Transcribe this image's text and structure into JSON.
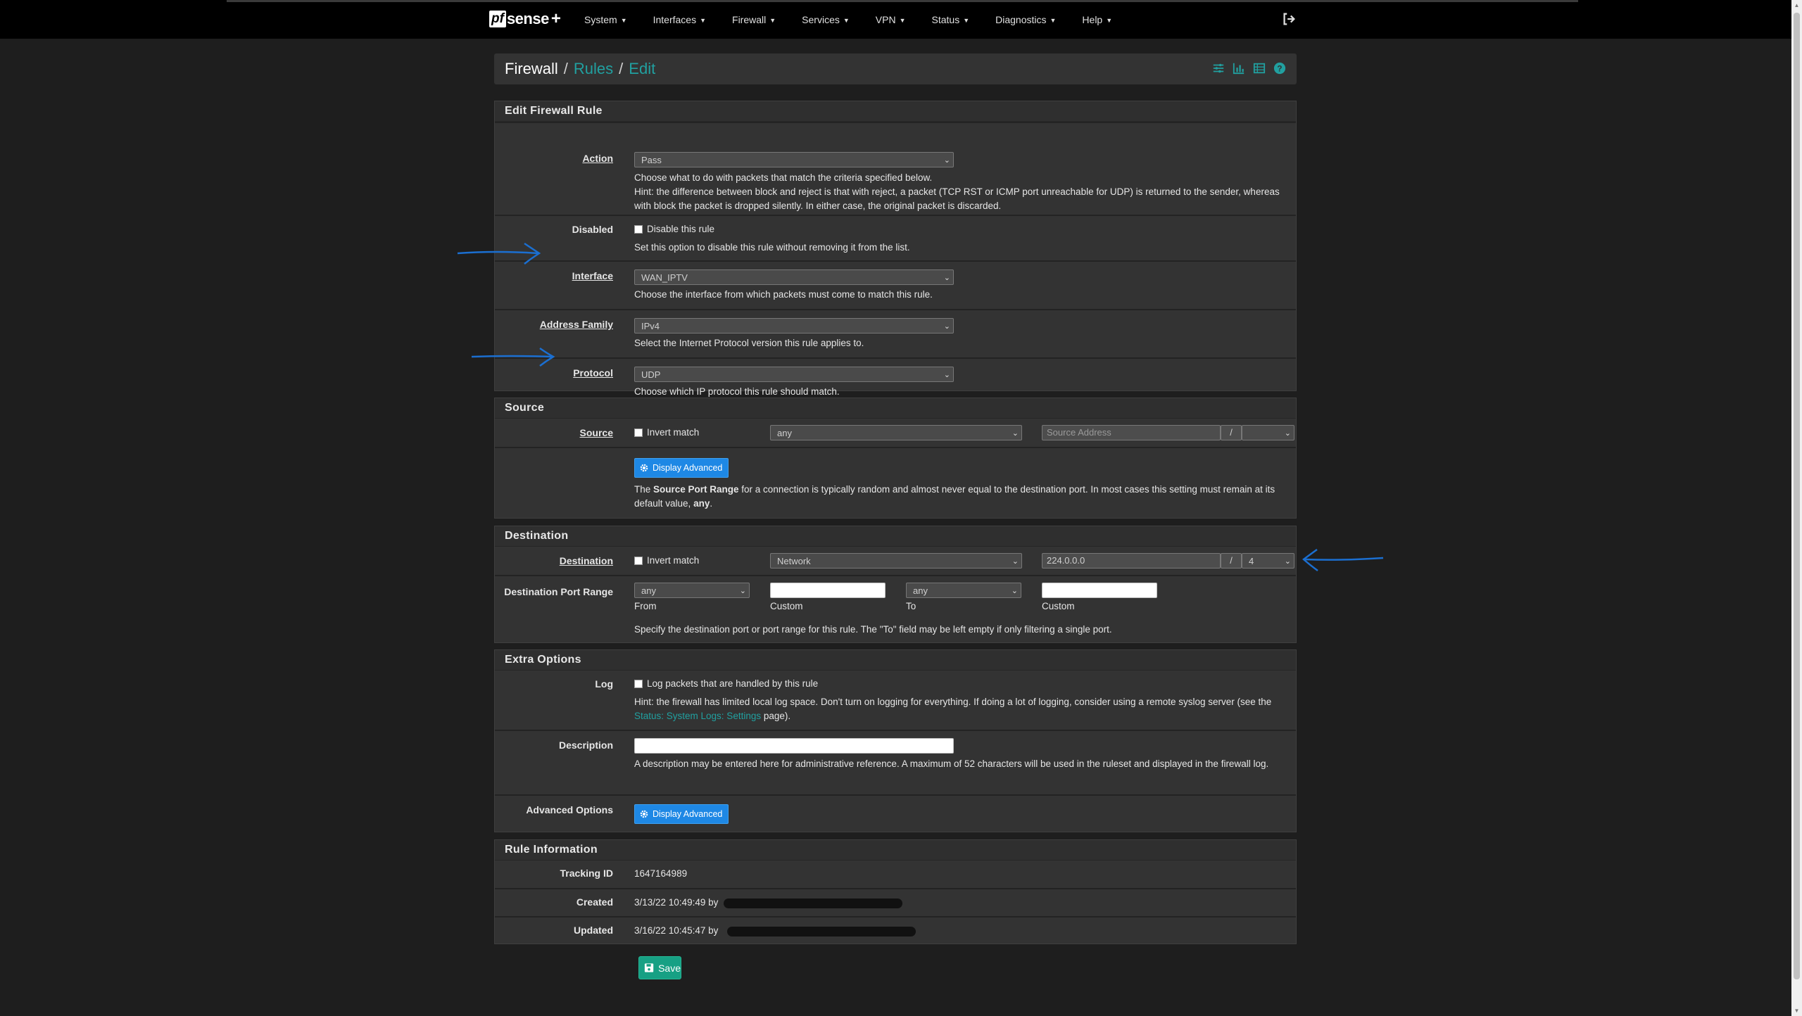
{
  "nav": {
    "brand_pf": "pf",
    "brand_sense": "sense",
    "brand_plus": "+",
    "items": [
      "System",
      "Interfaces",
      "Firewall",
      "Services",
      "VPN",
      "Status",
      "Diagnostics",
      "Help"
    ]
  },
  "breadcrumb": {
    "root": "Firewall",
    "sep": "/",
    "rules": "Rules",
    "edit": "Edit"
  },
  "edit_rule": {
    "heading": "Edit Firewall Rule",
    "action": {
      "label": "Action",
      "value": "Pass",
      "help1": "Choose what to do with packets that match the criteria specified below.",
      "help2": "Hint: the difference between block and reject is that with reject, a packet (TCP RST or ICMP port unreachable for UDP) is returned to the sender, whereas with block the packet is dropped silently. In either case, the original packet is discarded."
    },
    "disabled": {
      "label": "Disabled",
      "checkbox": "Disable this rule",
      "help": "Set this option to disable this rule without removing it from the list."
    },
    "interface": {
      "label": "Interface",
      "value": "WAN_IPTV",
      "help": "Choose the interface from which packets must come to match this rule."
    },
    "address_family": {
      "label": "Address Family",
      "value": "IPv4",
      "help": "Select the Internet Protocol version this rule applies to."
    },
    "protocol": {
      "label": "Protocol",
      "value": "UDP",
      "help": "Choose which IP protocol this rule should match."
    }
  },
  "source": {
    "heading": "Source",
    "label": "Source",
    "invert": "Invert match",
    "type": "any",
    "address_placeholder": "Source Address",
    "slash": "/",
    "display_advanced": "Display Advanced",
    "help_pre": "The ",
    "help_bold": "Source Port Range",
    "help_mid": " for a connection is typically random and almost never equal to the destination port. In most cases this setting must remain at its default value, ",
    "help_bold2": "any",
    "help_end": "."
  },
  "destination": {
    "heading": "Destination",
    "label": "Destination",
    "invert": "Invert match",
    "type": "Network",
    "address": "224.0.0.0",
    "slash": "/",
    "mask": "4",
    "port_range_label": "Destination Port Range",
    "from_value": "any",
    "to_value": "any",
    "from": "From",
    "custom": "Custom",
    "to": "To",
    "help": "Specify the destination port or port range for this rule. The \"To\" field may be left empty if only filtering a single port."
  },
  "extra": {
    "heading": "Extra Options",
    "log": {
      "label": "Log",
      "checkbox": "Log packets that are handled by this rule",
      "help_pre": "Hint: the firewall has limited local log space. Don't turn on logging for everything. If doing a lot of logging, consider using a remote syslog server (see the ",
      "help_link": "Status: System Logs: Settings",
      "help_end": " page)."
    },
    "description": {
      "label": "Description",
      "help": "A description may be entered here for administrative reference. A maximum of 52 characters will be used in the ruleset and displayed in the firewall log."
    },
    "advanced": {
      "label": "Advanced Options",
      "button": "Display Advanced"
    }
  },
  "info": {
    "heading": "Rule Information",
    "tracking": {
      "label": "Tracking ID",
      "value": "1647164989"
    },
    "created": {
      "label": "Created",
      "value": "3/13/22 10:49:49 by"
    },
    "updated": {
      "label": "Updated",
      "value": "3/16/22 10:45:47 by"
    }
  },
  "save": "Save",
  "colors": {
    "accent": "#21a0a0",
    "button_blue": "#1e88e5",
    "save_green": "#17a084",
    "annotation": "#1b6fd1"
  }
}
